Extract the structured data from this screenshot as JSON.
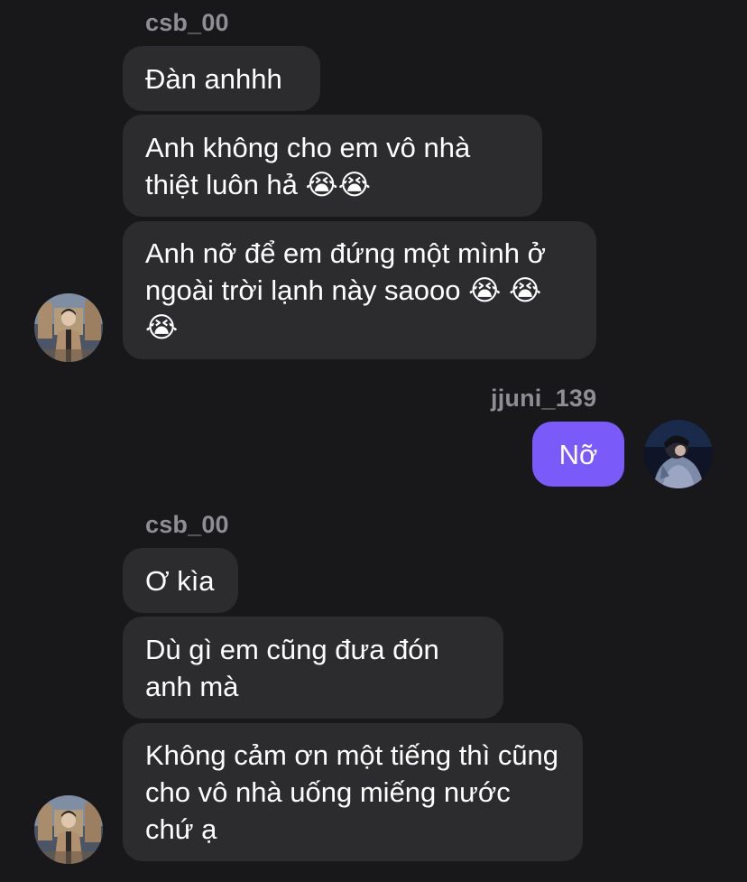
{
  "conversation": {
    "group1": {
      "sender": "csb_00",
      "messages": [
        {
          "text": "Đàn anhhh"
        },
        {
          "text": "Anh không cho em vô nhà thiệt luôn hả 😭😭"
        },
        {
          "text": "Anh nỡ để em đứng một mình ở ngoài trời lạnh này saooo 😭 😭😭"
        }
      ]
    },
    "group2": {
      "sender": "jjuni_139",
      "messages": [
        {
          "text": "Nỡ"
        }
      ]
    },
    "group3": {
      "sender": "csb_00",
      "messages": [
        {
          "text": "Ơ kìa"
        },
        {
          "text": "Dù gì em cũng đưa đón anh mà"
        },
        {
          "text": "Không cảm ơn một tiếng thì cũng cho vô nhà uống miếng nước chứ ạ"
        }
      ]
    }
  },
  "colors": {
    "background": "#18181a",
    "received_bubble": "#2c2c2e",
    "sent_bubble": "#7a5af8",
    "sender_name": "#8e8e93"
  },
  "icons": {
    "received_avatar": "user-photo-avatar",
    "sent_avatar": "user-photo-avatar",
    "emoji": "loudly-crying-face"
  }
}
